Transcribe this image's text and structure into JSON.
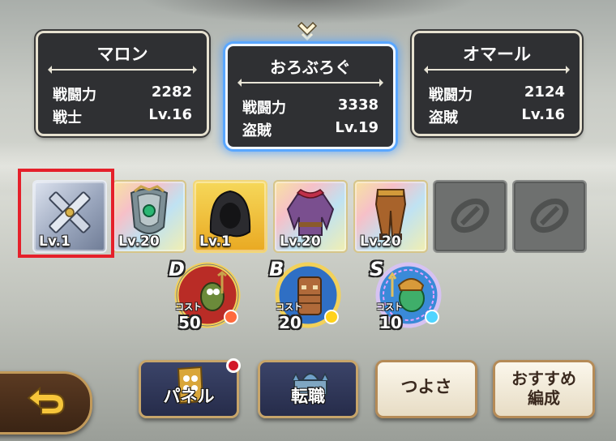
{
  "party": {
    "members": [
      {
        "name": "マロン",
        "power_label": "戦闘力",
        "power": "2282",
        "job": "戦士",
        "level": "Lv.16"
      },
      {
        "name": "おろぶろぐ",
        "power_label": "戦闘力",
        "power": "3338",
        "job": "盗賊",
        "level": "Lv.19"
      },
      {
        "name": "オマール",
        "power_label": "戦闘力",
        "power": "2124",
        "job": "盗賊",
        "level": "Lv.16"
      }
    ],
    "selected_index": 1
  },
  "equipment": {
    "slots": [
      {
        "item": "boomerang-icon",
        "level": "Lv.1",
        "frame": "silver"
      },
      {
        "item": "shield-icon",
        "level": "Lv.20",
        "frame": "rainbow"
      },
      {
        "item": "hood-icon",
        "level": "Lv.1",
        "frame": "gold"
      },
      {
        "item": "armor-top-icon",
        "level": "Lv.20",
        "frame": "rainbow"
      },
      {
        "item": "armor-bottom-icon",
        "level": "Lv.20",
        "frame": "rainbow"
      },
      {
        "item": "empty-accessory-icon",
        "level": "",
        "frame": "empty"
      },
      {
        "item": "empty-accessory-icon",
        "level": "",
        "frame": "empty"
      }
    ]
  },
  "monsters": [
    {
      "rank": "D",
      "cost_label": "コスト",
      "cost": "50",
      "gem_color": "#ff6a3d"
    },
    {
      "rank": "B",
      "cost_label": "コスト",
      "cost": "20",
      "gem_color": "#ffd21a"
    },
    {
      "rank": "S",
      "cost_label": "コスト",
      "cost": "10",
      "gem_color": "#4fd4ff"
    }
  ],
  "buttons": {
    "back": "back-arrow-icon",
    "panel": "パネル",
    "job_change": "転職",
    "strength": "つよさ",
    "recommended": "おすすめ\n編成"
  },
  "colors": {
    "selection_glow": "#5aa7ff",
    "highlight_frame": "#e5202a",
    "notification": "#d2182a"
  }
}
